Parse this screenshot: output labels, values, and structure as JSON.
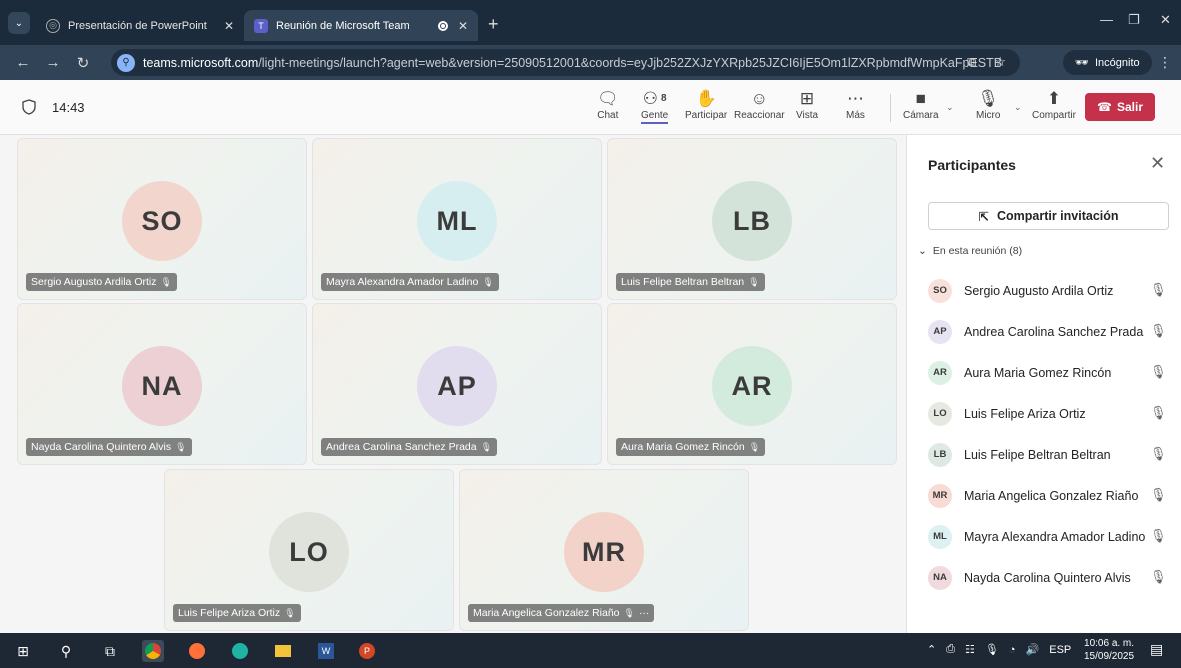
{
  "browser": {
    "tabs": [
      {
        "title": "Presentación de PowerPoint",
        "active": false
      },
      {
        "title": "Reunión de Microsoft Team",
        "active": true
      }
    ],
    "url_host": "teams.microsoft.com",
    "url_rest": "/light-meetings/launch?agent=web&version=25090512001&coords=eyJjb252ZXJzYXRpb25JZCI6IjE5Om1lZXRpbmdfWmpKaFpESTBOel...",
    "incognito_label": "Incógnito"
  },
  "meeting": {
    "time": "14:43",
    "controls": [
      {
        "label": "Chat",
        "icon": "chat-icon"
      },
      {
        "label": "Gente",
        "icon": "people-icon",
        "count": "8"
      },
      {
        "label": "Participar",
        "icon": "raise-hand-icon"
      },
      {
        "label": "Reaccionar",
        "icon": "smiley-icon"
      },
      {
        "label": "Vista",
        "icon": "grid-view-icon"
      },
      {
        "label": "Más",
        "icon": "more-icon"
      },
      {
        "label": "Cámara",
        "icon": "camera-off-icon"
      },
      {
        "label": "Micro",
        "icon": "mic-off-icon"
      },
      {
        "label": "Compartir",
        "icon": "share-icon"
      }
    ],
    "leave_label": "Salir"
  },
  "tiles": [
    {
      "initials": "SO",
      "name": "Sergio Augusto Ardila Ortiz",
      "color": "#f2d6cd"
    },
    {
      "initials": "ML",
      "name": "Mayra Alexandra Amador Ladino",
      "color": "#d6eef0"
    },
    {
      "initials": "LB",
      "name": "Luis Felipe Beltran Beltran",
      "color": "#d3e3da"
    },
    {
      "initials": "NA",
      "name": "Nayda Carolina Quintero Alvis",
      "color": "#ecd0d3"
    },
    {
      "initials": "AP",
      "name": "Andrea Carolina Sanchez Prada",
      "color": "#e2dcef"
    },
    {
      "initials": "AR",
      "name": "Aura Maria Gomez Rincón",
      "color": "#d3ebdd"
    },
    {
      "initials": "LO",
      "name": "Luis Felipe Ariza Ortiz",
      "color": "#dfe3db"
    },
    {
      "initials": "MR",
      "name": "Maria Angelica Gonzalez Riaño",
      "color": "#f3d3c9",
      "more": "···"
    }
  ],
  "participants_pane": {
    "title": "Participantes",
    "invite_label": "Compartir invitación",
    "section_label": "En esta reunión (8)",
    "people": [
      {
        "initials": "SO",
        "name": "Sergio Augusto Ardila Ortiz",
        "color": "#f7e1da"
      },
      {
        "initials": "AP",
        "name": "Andrea Carolina Sanchez Prada",
        "color": "#e8e3f3"
      },
      {
        "initials": "AR",
        "name": "Aura Maria Gomez Rincón",
        "color": "#dcf0e4"
      },
      {
        "initials": "LO",
        "name": "Luis Felipe Ariza Ortiz",
        "color": "#e6e9e2"
      },
      {
        "initials": "LB",
        "name": "Luis Felipe Beltran Beltran",
        "color": "#dde9e2"
      },
      {
        "initials": "MR",
        "name": "Maria Angelica Gonzalez Riaño",
        "color": "#f8dcd3"
      },
      {
        "initials": "ML",
        "name": "Mayra Alexandra Amador Ladino",
        "color": "#ddf0f2"
      },
      {
        "initials": "NA",
        "name": "Nayda Carolina Quintero Alvis",
        "color": "#f1dadd"
      }
    ]
  },
  "taskbar": {
    "lang": "ESP",
    "time": "10:06 a. m.",
    "date": "15/09/2025"
  }
}
